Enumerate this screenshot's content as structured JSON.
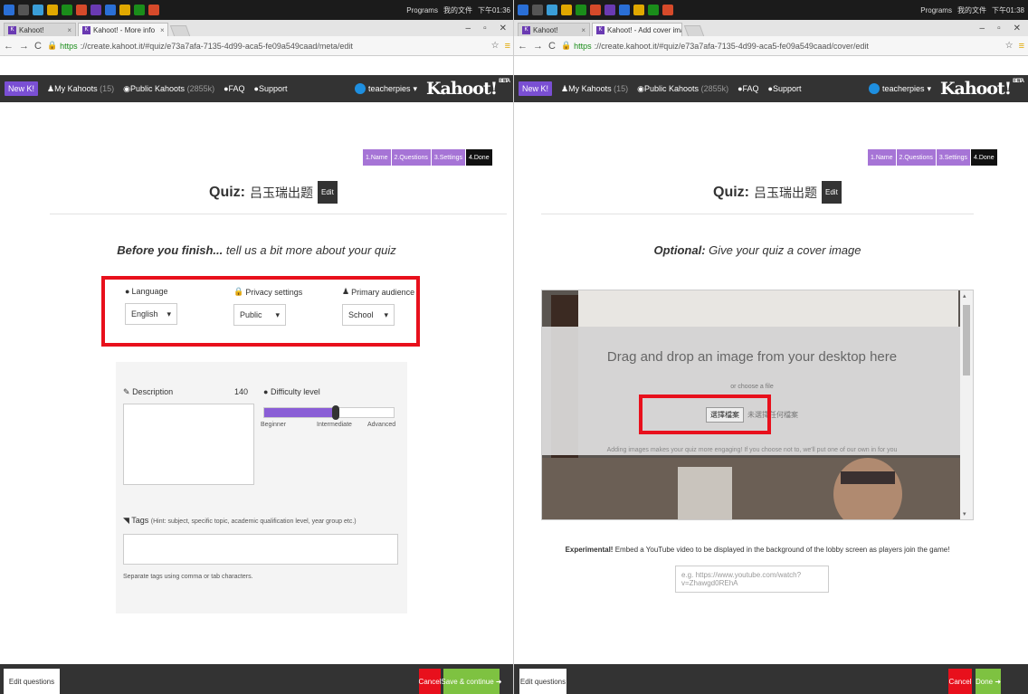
{
  "left": {
    "taskbar": {
      "programs": "Programs",
      "extra": "我的文件",
      "time": "下午01:36"
    },
    "tabs": [
      {
        "label": "Kahoot!"
      },
      {
        "label": "Kahoot! - More info"
      }
    ],
    "url": {
      "secure": "https",
      "rest": "://create.kahoot.it/#quiz/e73a7afa-7135-4d99-aca5-fe09a549caad/meta/edit"
    },
    "app": {
      "new": "New K!",
      "my": "My Kahoots",
      "my_count": "(15)",
      "public": "Public Kahoots",
      "public_count": "(2855k)",
      "faq": "FAQ",
      "support": "Support",
      "user": "teacherpies",
      "logo": "Kahoot!",
      "beta": "BETA"
    },
    "steps": [
      "1.Name",
      "2.Questions",
      "3.Settings",
      "4.Done"
    ],
    "quiz": {
      "prefix": "Quiz:",
      "name": "吕玉瑞出题",
      "edit": "Edit"
    },
    "subhead": {
      "bold": "Before you finish...",
      "rest": " tell us a bit more about your quiz"
    },
    "settings": {
      "language": {
        "label": "Language",
        "value": "English"
      },
      "privacy": {
        "label": "Privacy settings",
        "value": "Public"
      },
      "audience": {
        "label": "Primary audience",
        "value": "School"
      }
    },
    "description": {
      "label": "Description",
      "count": "140"
    },
    "difficulty": {
      "label": "Difficulty level",
      "level": 0.55,
      "beginner": "Beginner",
      "intermediate": "Intermediate",
      "advanced": "Advanced"
    },
    "tags": {
      "label": "Tags",
      "hint": "(Hint: subject, specific topic, academic qualification level, year group etc.)",
      "help": "Separate tags using comma or tab characters."
    },
    "bottom": {
      "edit": "Edit questions",
      "cancel": "Cancel",
      "save": "Save & continue"
    }
  },
  "right": {
    "taskbar": {
      "programs": "Programs",
      "extra": "我的文件",
      "time": "下午01:38"
    },
    "tabs": [
      {
        "label": "Kahoot!"
      },
      {
        "label": "Kahoot! - Add cover ima"
      }
    ],
    "url": {
      "secure": "https",
      "rest": "://create.kahoot.it/#quiz/e73a7afa-7135-4d99-aca5-fe09a549caad/cover/edit"
    },
    "app": {
      "new": "New K!",
      "my": "My Kahoots",
      "my_count": "(15)",
      "public": "Public Kahoots",
      "public_count": "(2855k)",
      "faq": "FAQ",
      "support": "Support",
      "user": "teacherpies",
      "logo": "Kahoot!",
      "beta": "BETA"
    },
    "steps": [
      "1.Name",
      "2.Questions",
      "3.Settings",
      "4.Done"
    ],
    "quiz": {
      "prefix": "Quiz:",
      "name": "吕玉瑞出题",
      "edit": "Edit"
    },
    "subhead": {
      "bold": "Optional:",
      "rest": " Give your quiz a cover image"
    },
    "cover": {
      "dnd": "Drag and drop an image from your desktop here",
      "choose": "or choose a file",
      "file_button": "選擇檔案",
      "file_status": "未選擇任何檔案",
      "note": "Adding images makes your quiz more engaging! If you choose not to, we'll put one of our own in for you"
    },
    "experimental": {
      "bold": "Experimental!",
      "rest": " Embed a YouTube video to be displayed in the background of the lobby screen as players join the game!"
    },
    "youtube_placeholder": "e.g. https://www.youtube.com/watch?v=Zhawgd0REhA",
    "bottom": {
      "edit": "Edit questions",
      "cancel": "Cancel",
      "done": "Done"
    }
  },
  "colors": {
    "accent": "#7a4fd3",
    "highlight": "#e8101c",
    "save": "#7ec241",
    "dark": "#333333"
  }
}
